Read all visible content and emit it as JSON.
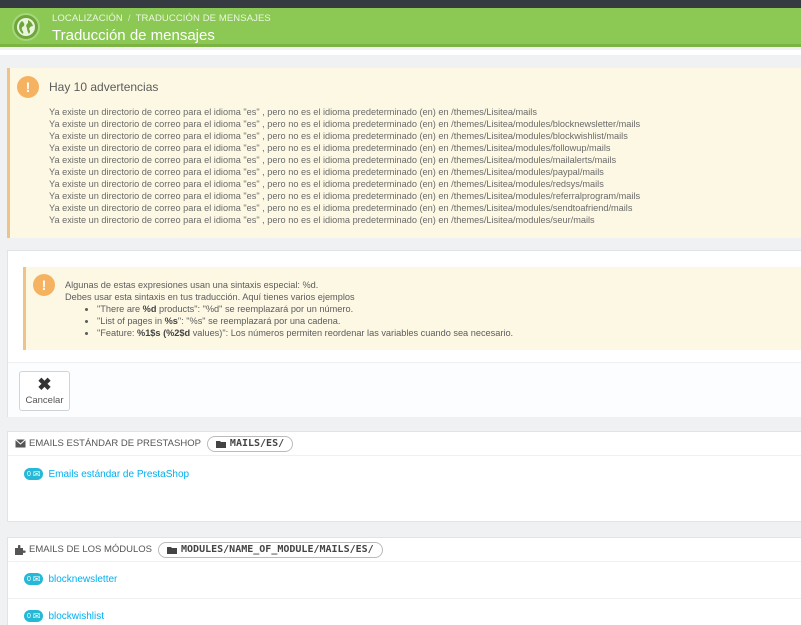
{
  "header": {
    "breadcrumb": [
      "LOCALIZACIÓN",
      "TRADUCCIÓN DE MENSAJES"
    ],
    "breadcrumb_separator": "/",
    "title": "Traducción de mensajes",
    "icon": "globe-icon",
    "colors": {
      "bar": "#8bc954",
      "topbar": "#363a41"
    }
  },
  "warnings": {
    "title": "Hay 10 advertencias",
    "icon_glyph": "!",
    "items": [
      "Ya existe un directorio de correo para el idioma \"es\" , pero no es el idioma predeterminado (en) en /themes/Lisitea/mails",
      "Ya existe un directorio de correo para el idioma \"es\" , pero no es el idioma predeterminado (en) en /themes/Lisitea/modules/blocknewsletter/mails",
      "Ya existe un directorio de correo para el idioma \"es\" , pero no es el idioma predeterminado (en) en /themes/Lisitea/modules/blockwishlist/mails",
      "Ya existe un directorio de correo para el idioma \"es\" , pero no es el idioma predeterminado (en) en /themes/Lisitea/modules/followup/mails",
      "Ya existe un directorio de correo para el idioma \"es\" , pero no es el idioma predeterminado (en) en /themes/Lisitea/modules/mailalerts/mails",
      "Ya existe un directorio de correo para el idioma \"es\" , pero no es el idioma predeterminado (en) en /themes/Lisitea/modules/paypal/mails",
      "Ya existe un directorio de correo para el idioma \"es\" , pero no es el idioma predeterminado (en) en /themes/Lisitea/modules/redsys/mails",
      "Ya existe un directorio de correo para el idioma \"es\" , pero no es el idioma predeterminado (en) en /themes/Lisitea/modules/referralprogram/mails",
      "Ya existe un directorio de correo para el idioma \"es\" , pero no es el idioma predeterminado (en) en /themes/Lisitea/modules/sendtoafriend/mails",
      "Ya existe un directorio de correo para el idioma \"es\" , pero no es el idioma predeterminado (en) en /themes/Lisitea/modules/seur/mails"
    ]
  },
  "syntax_info": {
    "icon_glyph": "!",
    "line1": "Algunas de estas expresiones usan una sintaxis especial: %d.",
    "line2": "Debes usar esta sintaxis en tus traducción. Aquí tienes varios ejemplos",
    "examples": [
      {
        "pre": "\"There are ",
        "bold": "%d",
        "post": " products\": \"%d\" se reemplazará por un número."
      },
      {
        "pre": "\"List of pages in ",
        "bold": "%s",
        "post": "\": \"%s\" se reemplazará por una cadena."
      },
      {
        "pre": "\"Feature: ",
        "bold": "%1$s (%2$d",
        "post": " values)\": Los números permiten reordenar las variables cuando sea necesario."
      }
    ]
  },
  "cancel_button": {
    "label": "Cancelar",
    "glyph": "✖"
  },
  "sections": [
    {
      "title": "EMAILS ESTÁNDAR DE PRESTASHOP",
      "path": "MAILS/ES/",
      "links": [
        "Emails estándar de PrestaShop"
      ]
    },
    {
      "title": "EMAILS DE LOS MÓDULOS",
      "path": "MODULES/NAME_OF_MODULE/MAILS/ES/",
      "links": [
        "blocknewsletter",
        "blockwishlist"
      ]
    }
  ],
  "mail_badge": {
    "count": "0",
    "glyph": "✉"
  }
}
